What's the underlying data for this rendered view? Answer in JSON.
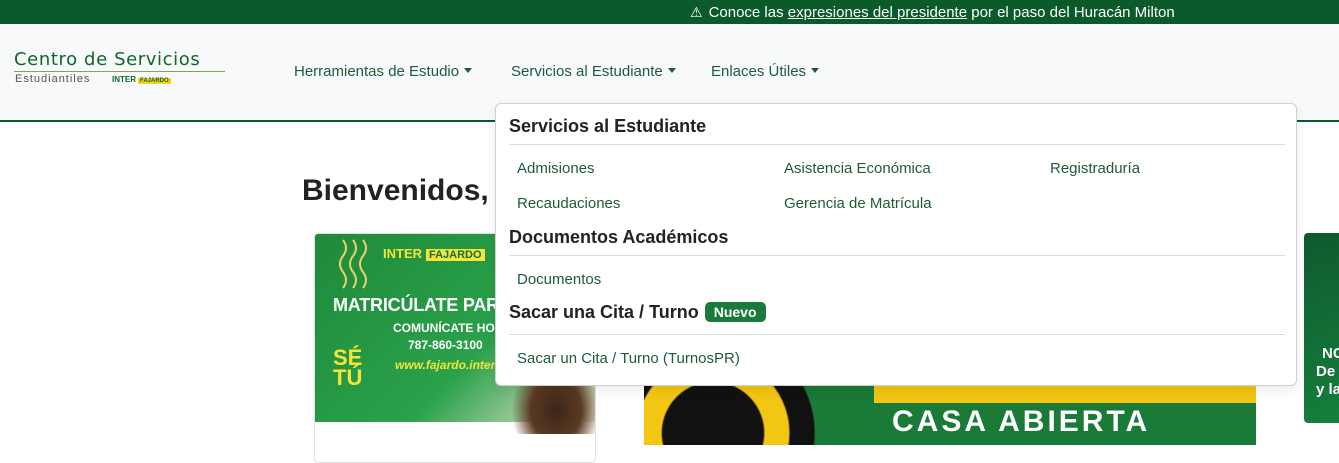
{
  "alert": {
    "icon": "warning-icon",
    "prefix": "Conoce las ",
    "link": "expresiones del presidente",
    "suffix": " por el paso del Huracán Milton"
  },
  "logo": {
    "line1": "Centro de Servicios",
    "line2": "Estudiantiles",
    "inter": "INTER",
    "campus": "FAJARDO"
  },
  "nav": {
    "items": [
      {
        "label": "Herramientas de Estudio"
      },
      {
        "label": "Servicios al Estudiante"
      },
      {
        "label": "Enlaces Útiles"
      }
    ]
  },
  "page": {
    "title": "Bienvenidos, e"
  },
  "card1": {
    "inter": "INTER",
    "campus": "FAJARDO",
    "headline": "MATRICÚLATE PARA E",
    "contact": "COMUNÍCATE HOY",
    "phone": "787-860-3100",
    "url": "www.fajardo.inter.ed",
    "side": "SÉ TÚ"
  },
  "banner": {
    "text": "CASA ABIERTA"
  },
  "card_right": {
    "l1": "NC",
    "l2": "De",
    "l3": "y la"
  },
  "dropdown": {
    "sections": [
      {
        "heading": "Servicios al Estudiante",
        "links": [
          "Admisiones",
          "Asistencia Económica",
          "Registraduría",
          "Recaudaciones",
          "Gerencia de Matrícula"
        ]
      },
      {
        "heading": "Documentos Académicos",
        "links": [
          "Documentos"
        ]
      },
      {
        "heading": "Sacar una Cita / Turno",
        "badge": "Nuevo",
        "links": [
          "Sacar un Cita / Turno (TurnosPR)"
        ]
      }
    ]
  },
  "colors": {
    "brand_green": "#0b5a2c",
    "link_green": "#1d5c37",
    "badge_green": "#1a7a3d"
  }
}
